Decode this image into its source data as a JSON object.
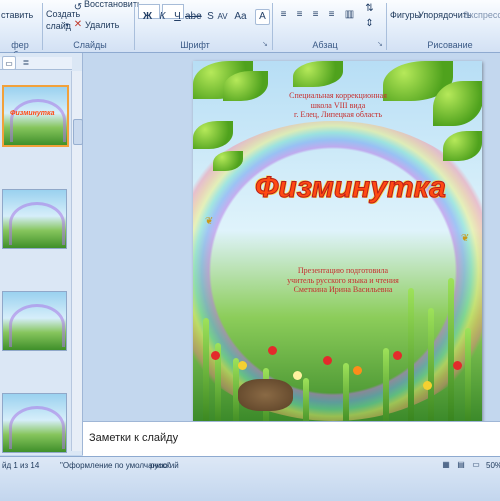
{
  "ribbon": {
    "paste_label": "ставить",
    "clipboard_group": "фер обм...",
    "create_slide_line1": "Создать",
    "create_slide_line2": "слайд",
    "restore_label": "Восстановить",
    "delete_label": "Удалить",
    "slides_group": "Слайды",
    "font_group": "Шрифт",
    "paragraph_group": "Абзац",
    "shapes_label": "Фигуры",
    "arrange_label": "Упорядочить",
    "express_label": "Экспресс-ст",
    "drawing_group": "Рисование"
  },
  "slide": {
    "school_line1": "Специальная коррекционная",
    "school_line2": "школа VIII вида",
    "school_line3": "г. Елец, Липецкая область",
    "title": "Физминутка",
    "author_line1": "Презентацию подготовила",
    "author_line2": "учитель русского языка и чтения",
    "author_line3": "Сметкина Ирина Васильевна"
  },
  "thumbnail_title": "Физминутка",
  "notes": {
    "placeholder": "Заметки к слайду"
  },
  "status": {
    "slide_counter": "йд 1 из 14",
    "theme": "\"Оформление по умолчанию\"",
    "language": "русский",
    "zoom": "50%"
  },
  "colors": {
    "accent": "#ff4a12",
    "slide_text": "#c62f2f"
  }
}
